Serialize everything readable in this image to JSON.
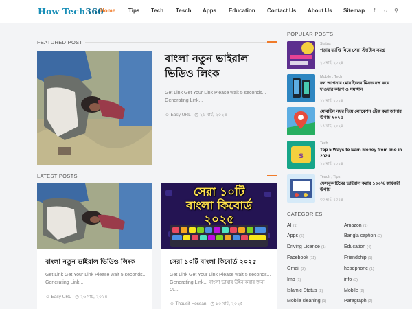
{
  "header": {
    "logo_part1": "How Tech",
    "logo_part2": "360",
    "nav": [
      "Home",
      "Tips",
      "Tech",
      "Tesch",
      "Apps",
      "Education",
      "Contact Us",
      "About Us",
      "Sitemap"
    ],
    "icons": [
      "facebook-icon",
      "menu-icon",
      "search-icon"
    ]
  },
  "featured": {
    "heading": "FEATURED POST",
    "title": "বাংলা নতুন ভাইরাল ভিডিও লিংক",
    "excerpt": "Get Link Get Your Link Please wait 5 seconds... Generating Link...",
    "author": "Easy URL",
    "date": "২৬ মার্চ, ২০২৪"
  },
  "latest": {
    "heading": "LATEST POSTS",
    "posts": [
      {
        "title": "বাংলা নতুন ভাইরাল ভিডিও লিংক",
        "excerpt": "Get Link Get Your Link Please wait 5 seconds... Generating Link...",
        "author": "Easy URL",
        "date": "২৬ মার্চ, ২০২৪"
      },
      {
        "title": "সেরা ১০টি বাংলা কিবোর্ড ২০২৫",
        "excerpt": "Get Link Get Your Link Please wait 5 seconds... Generating Link... বাংলা ভাষার উইন করার জন্য যে...",
        "author": "Thousif Hossan",
        "date": "১০ মার্চ, ২০২৫",
        "thumb_text_line1": "সেরা ১০টি",
        "thumb_text_line2": "বাংলা কিবোর্ড",
        "thumb_text_line3": "২০২৫"
      }
    ]
  },
  "popular": {
    "heading": "POPULAR POSTS",
    "items": [
      {
        "cat": "Status",
        "title": "পড়ার ব্যাপ্তি নিয়ে সেরা স্ট্যাটাস সমগ্র",
        "date": "২৩ মার্চ, ২০২৪"
      },
      {
        "cat": "Mobile , Tech",
        "title": "ফন আপনার মোবাইলের মিসড বন্ধ করে দাওয়ার কারণ ও সমাধান",
        "date": "১৮ মার্চ, ২০২৪"
      },
      {
        "cat": "",
        "title": "মোবাইল নম্বর দিয়ে লোকেশন ট্রেক করা জানার উপায় ২০২৪",
        "date": "১৭ মার্চ, ২০২৪"
      },
      {
        "cat": "Tech",
        "title": "Top 5 Ways to Earn Money from Imo in 2024",
        "date": "১২ মার্চ, ২০২৪"
      },
      {
        "cat": "Teach , Tips",
        "title": "ফেসবুক টিমের ভাইরাল করার ১০০% কার্যকরী উপায়",
        "date": "৩০ মার্চ, ২০২৪"
      }
    ]
  },
  "categories": {
    "heading": "CATEGORIES",
    "items": [
      {
        "name": "AI",
        "count": "(1)"
      },
      {
        "name": "Amazon",
        "count": "(1)"
      },
      {
        "name": "Apps",
        "count": "(6)"
      },
      {
        "name": "Bangla caption",
        "count": "(2)"
      },
      {
        "name": "Driving Licence",
        "count": "(1)"
      },
      {
        "name": "Education",
        "count": "(4)"
      },
      {
        "name": "Facebook",
        "count": "(11)"
      },
      {
        "name": "Friendship",
        "count": "(1)"
      },
      {
        "name": "Gmail",
        "count": "(2)"
      },
      {
        "name": "headphone",
        "count": "(1)"
      },
      {
        "name": "Imo",
        "count": "(1)"
      },
      {
        "name": "info",
        "count": "(3)"
      },
      {
        "name": "Islamic Status",
        "count": "(2)"
      },
      {
        "name": "Mobile",
        "count": "(2)"
      },
      {
        "name": "Mobile cleaning",
        "count": "(1)"
      },
      {
        "name": "Paragraph",
        "count": "(2)"
      }
    ]
  },
  "colors": {
    "accent": "#f07b2a",
    "brand": "#1a8fb8"
  }
}
